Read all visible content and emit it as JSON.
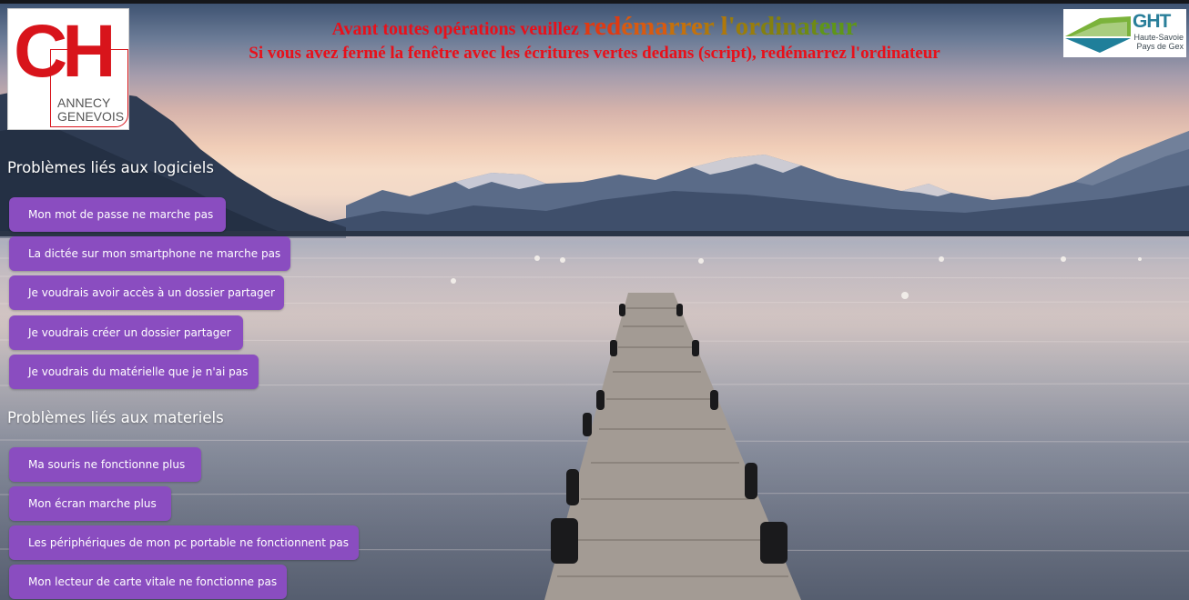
{
  "logos": {
    "left": {
      "letters": "CH",
      "line1": "ANNECY",
      "line2": "GENEVOIS"
    },
    "right": {
      "word": "GHT",
      "line1": "Haute-Savoie",
      "line2": "Pays de Gex"
    }
  },
  "header": {
    "line1_prefix": "Avant toutes opérations veuillez",
    "line1_emphasis": [
      "r",
      "e",
      "d",
      "é",
      "m",
      "a",
      "r",
      "r",
      "e",
      "r",
      " ",
      "l",
      "'",
      "o",
      "r",
      "d",
      "i",
      "n",
      "a",
      "t",
      "e",
      "u",
      "r"
    ],
    "line2": "Si vous avez fermé la fenêtre avec les écritures vertes dedans (script), redémarrez l'ordinateur"
  },
  "sections": [
    {
      "title": "Problèmes liés aux logiciels",
      "buttons": [
        "Mon mot de passe ne marche pas",
        "La dictée sur mon smartphone ne marche pas",
        "Je voudrais avoir accès à un dossier partager",
        "Je voudrais créer un dossier partager",
        "Je voudrais du matérielle que je n'ai pas"
      ]
    },
    {
      "title": "Problèmes liés aux materiels",
      "buttons": [
        "Ma souris ne fonctionne plus",
        "Mon écran marche plus",
        "Les périphériques de mon pc portable ne fonctionnent pas",
        "Mon lecteur de carte vitale ne fonctionne pas"
      ]
    }
  ],
  "colors": {
    "button_bg": "#8a4dc0",
    "header_red": "#e8101a",
    "logo_red": "#d8141b"
  }
}
